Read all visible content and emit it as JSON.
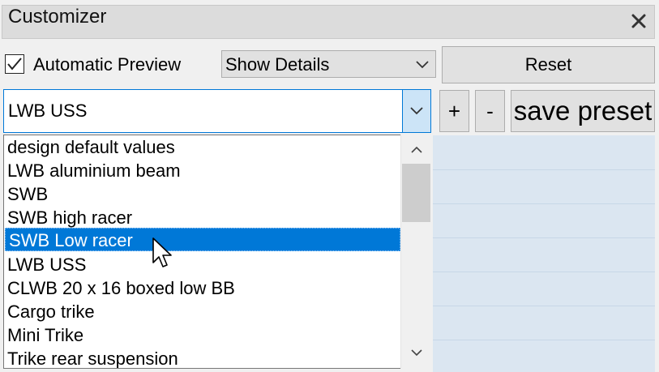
{
  "panel": {
    "title": "Customizer",
    "close_icon": "close-icon"
  },
  "toolbar": {
    "auto_preview": {
      "label": "Automatic Preview",
      "checked": true
    },
    "details_combo": {
      "selected": "Show Details"
    },
    "reset_label": "Reset"
  },
  "presets": {
    "selected": "LWB USS",
    "add_label": "+",
    "remove_label": "-",
    "save_label": "save preset",
    "highlighted_index": 4,
    "items": [
      "design default values",
      "LWB aluminium beam",
      "SWB",
      "SWB high racer",
      "SWB Low racer",
      "LWB USS",
      "CLWB 20  x 16 boxed low BB",
      "Cargo trike",
      "Mini Trike",
      "Trike rear suspension"
    ]
  },
  "colors": {
    "selection": "#0078d7",
    "background_panel": "#dbe6f1"
  }
}
